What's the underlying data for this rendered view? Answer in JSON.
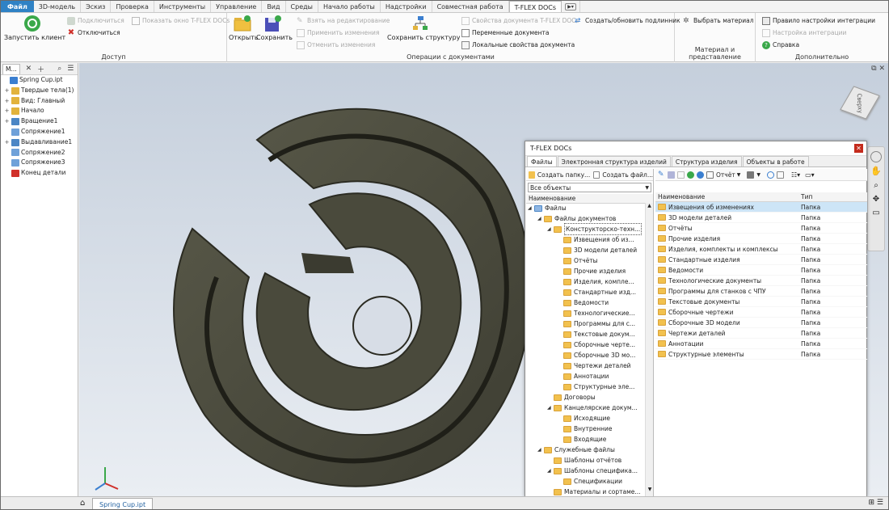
{
  "menu": {
    "tabs": [
      "Файл",
      "3D-модель",
      "Эскиз",
      "Проверка",
      "Инструменты",
      "Управление",
      "Вид",
      "Среды",
      "Начало работы",
      "Надстройки",
      "Совместная работа",
      "T-FLEX DOCs"
    ],
    "active": "T-FLEX DOCs"
  },
  "ribbon": {
    "access": {
      "title": "Доступ",
      "start_client": "Запустить клиент",
      "connect": "Подключиться",
      "disconnect": "Отключиться",
      "show_window": "Показать окно T-FLEX DOCs"
    },
    "docops": {
      "title": "Операции с документами",
      "open": "Открыть",
      "save": "Сохранить",
      "take_edit": "Взять на редактирование",
      "apply_changes": "Применить изменения",
      "cancel_changes": "Отменить изменения",
      "save_structure": "Сохранить структуру",
      "doc_props": "Свойства документа T-FLEX DOCs",
      "doc_vars": "Переменные документа",
      "local_props": "Локальные свойства документа",
      "create_original": "Создать/обновить подлинник"
    },
    "material": {
      "title": "Материал и представление",
      "choose": "Выбрать материал"
    },
    "extra": {
      "title": "Дополнительно",
      "rule": "Правило настройки интеграции",
      "settings": "Настройка интеграции",
      "help": "Справка"
    }
  },
  "browser": {
    "tab": "М...",
    "items": [
      {
        "pm": "",
        "label": "Spring Cup.ipt",
        "indent": 0,
        "color": "#3b7fd0"
      },
      {
        "pm": "+",
        "label": "Твердые тела(1)",
        "indent": 1,
        "color": "#e2b33c"
      },
      {
        "pm": "+",
        "label": "Вид: Главный",
        "indent": 1,
        "color": "#e2b33c"
      },
      {
        "pm": "+",
        "label": "Начало",
        "indent": 1,
        "color": "#e2b33c"
      },
      {
        "pm": "+",
        "label": "Вращение1",
        "indent": 1,
        "color": "#4b86c5"
      },
      {
        "pm": "",
        "label": "Сопряжение1",
        "indent": 1,
        "color": "#6fa1d9"
      },
      {
        "pm": "+",
        "label": "Выдавливание1",
        "indent": 1,
        "color": "#4b86c5"
      },
      {
        "pm": "",
        "label": "Сопряжение2",
        "indent": 1,
        "color": "#6fa1d9"
      },
      {
        "pm": "",
        "label": "Сопряжение3",
        "indent": 1,
        "color": "#6fa1d9"
      },
      {
        "pm": "",
        "label": "Конец детали",
        "indent": 1,
        "color": "#d0302a"
      }
    ]
  },
  "viewcube": {
    "label": "Сверху"
  },
  "doc_tab": "Spring Cup.ipt",
  "tflex": {
    "title": "T-FLEX DOCs",
    "tabs": [
      "Файлы",
      "Электронная структура изделий",
      "Структура изделия",
      "Объекты в работе"
    ],
    "left_toolbar": {
      "create_folder": "Создать папку...",
      "create_file": "Создать файл..."
    },
    "right_toolbar": {
      "report": "Отчёт"
    },
    "filter": "Все объекты",
    "left_header": "Наименование",
    "right_headers": {
      "name": "Наименование",
      "type": "Тип"
    },
    "tree": [
      {
        "label": "Файлы",
        "level": 0,
        "icon": "root",
        "open": true
      },
      {
        "label": "Файлы документов",
        "level": 1,
        "icon": "folder",
        "open": true
      },
      {
        "label": "Конструкторско-техн...",
        "level": 2,
        "icon": "folder",
        "open": true,
        "selected": true
      },
      {
        "label": "Извещения об из...",
        "level": 3,
        "icon": "folder"
      },
      {
        "label": "3D модели деталей",
        "level": 3,
        "icon": "folder"
      },
      {
        "label": "Отчёты",
        "level": 3,
        "icon": "folder"
      },
      {
        "label": "Прочие изделия",
        "level": 3,
        "icon": "folder"
      },
      {
        "label": "Изделия, компле...",
        "level": 3,
        "icon": "folder"
      },
      {
        "label": "Стандартные изд...",
        "level": 3,
        "icon": "folder"
      },
      {
        "label": "Ведомости",
        "level": 3,
        "icon": "folder"
      },
      {
        "label": "Технологические...",
        "level": 3,
        "icon": "folder"
      },
      {
        "label": "Программы для с...",
        "level": 3,
        "icon": "folder"
      },
      {
        "label": "Текстовые докум...",
        "level": 3,
        "icon": "folder"
      },
      {
        "label": "Сборочные черте...",
        "level": 3,
        "icon": "folder"
      },
      {
        "label": "Сборочные 3D мо...",
        "level": 3,
        "icon": "folder"
      },
      {
        "label": "Чертежи деталей",
        "level": 3,
        "icon": "folder"
      },
      {
        "label": "Аннотации",
        "level": 3,
        "icon": "folder"
      },
      {
        "label": "Структурные эле...",
        "level": 3,
        "icon": "folder"
      },
      {
        "label": "Договоры",
        "level": 2,
        "icon": "folder"
      },
      {
        "label": "Канцелярские докум...",
        "level": 2,
        "icon": "folder",
        "open": true
      },
      {
        "label": "Исходящие",
        "level": 3,
        "icon": "folder"
      },
      {
        "label": "Внутренние",
        "level": 3,
        "icon": "folder"
      },
      {
        "label": "Входящие",
        "level": 3,
        "icon": "folder"
      },
      {
        "label": "Служебные файлы",
        "level": 1,
        "icon": "folder",
        "open": true
      },
      {
        "label": "Шаблоны отчётов",
        "level": 2,
        "icon": "folder"
      },
      {
        "label": "Шаблоны специфика...",
        "level": 2,
        "icon": "folder",
        "open": true
      },
      {
        "label": "Спецификации",
        "level": 3,
        "icon": "folder"
      },
      {
        "label": "Материалы и сортаме...",
        "level": 2,
        "icon": "folder"
      }
    ],
    "list": [
      {
        "name": "Извещения об изменениях",
        "type": "Папка",
        "selected": true
      },
      {
        "name": "3D модели деталей",
        "type": "Папка"
      },
      {
        "name": "Отчёты",
        "type": "Папка"
      },
      {
        "name": "Прочие изделия",
        "type": "Папка"
      },
      {
        "name": "Изделия, комплекты и комплексы",
        "type": "Папка"
      },
      {
        "name": "Стандартные изделия",
        "type": "Папка"
      },
      {
        "name": "Ведомости",
        "type": "Папка"
      },
      {
        "name": "Технологические документы",
        "type": "Папка"
      },
      {
        "name": "Программы для станков с ЧПУ",
        "type": "Папка"
      },
      {
        "name": "Текстовые документы",
        "type": "Папка"
      },
      {
        "name": "Сборочные чертежи",
        "type": "Папка"
      },
      {
        "name": "Сборочные 3D модели",
        "type": "Папка"
      },
      {
        "name": "Чертежи деталей",
        "type": "Папка"
      },
      {
        "name": "Аннотации",
        "type": "Папка"
      },
      {
        "name": "Структурные элементы",
        "type": "Папка"
      }
    ]
  },
  "colors": {
    "file_tab": "#2f82c5",
    "model": "#4b4b3e",
    "selection": "#cde5f7"
  }
}
